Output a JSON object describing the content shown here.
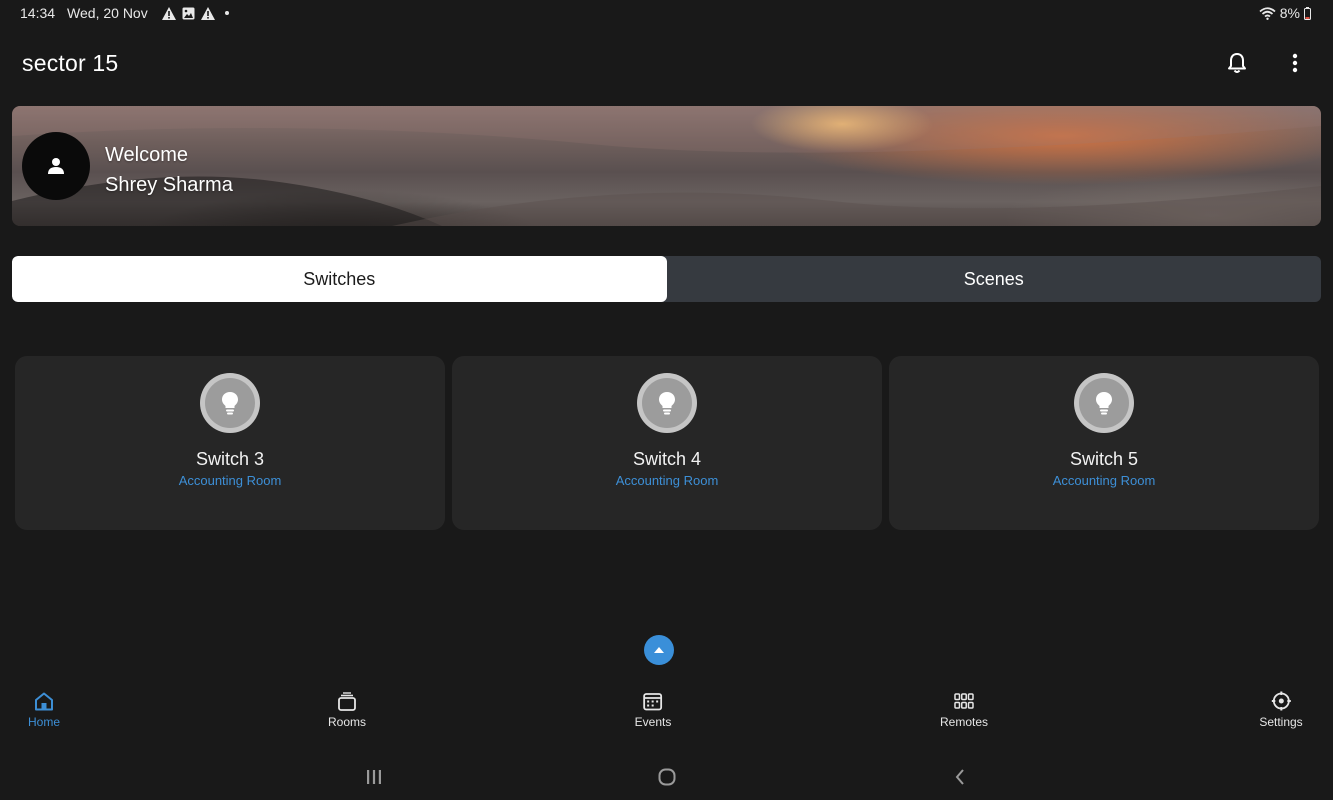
{
  "status_bar": {
    "time": "14:34",
    "date": "Wed, 20 Nov",
    "battery": "8%",
    "icons": [
      "warning-icon",
      "image-icon",
      "warning-icon",
      "wifi-icon",
      "battery-icon"
    ]
  },
  "app_bar": {
    "title": "sector 15",
    "actions": [
      "bell-icon",
      "more-vertical-icon"
    ]
  },
  "banner": {
    "welcome": "Welcome",
    "user_name": "Shrey Sharma"
  },
  "tabs": [
    {
      "label": "Switches",
      "active": true
    },
    {
      "label": "Scenes",
      "active": false
    }
  ],
  "switches": [
    {
      "name": "Switch 3",
      "room": "Accounting Room"
    },
    {
      "name": "Switch 4",
      "room": "Accounting Room"
    },
    {
      "name": "Switch 5",
      "room": "Accounting Room"
    }
  ],
  "bottom_nav": [
    {
      "label": "Home",
      "icon": "home-icon",
      "active": true
    },
    {
      "label": "Rooms",
      "icon": "rooms-icon",
      "active": false
    },
    {
      "label": "Events",
      "icon": "calendar-icon",
      "active": false
    },
    {
      "label": "Remotes",
      "icon": "grid-icon",
      "active": false
    },
    {
      "label": "Settings",
      "icon": "gear-icon",
      "active": false
    }
  ],
  "colors": {
    "background": "#191919",
    "card": "#262626",
    "accent": "#3d8fd6",
    "tab_inactive": "#363a40"
  }
}
